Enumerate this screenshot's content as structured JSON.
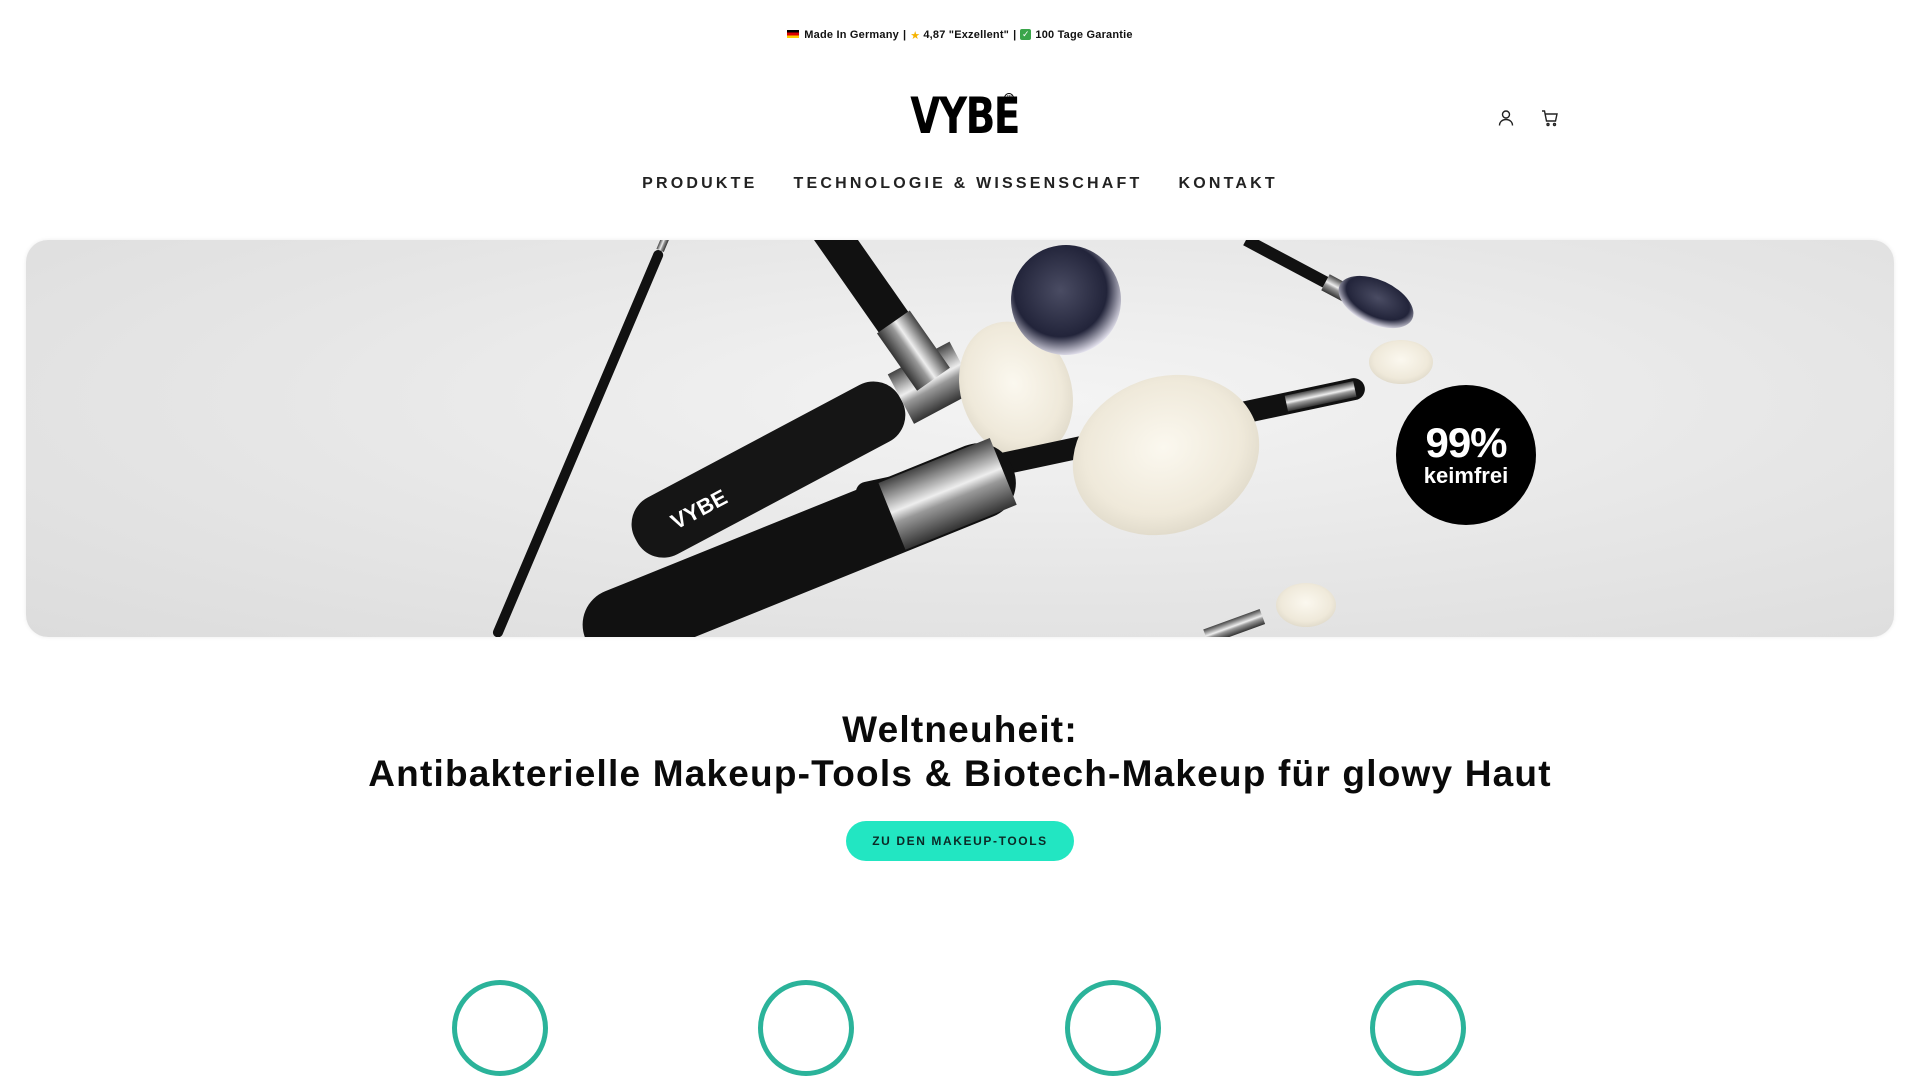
{
  "announcement": {
    "made_in": "Made In Germany",
    "rating": "4,87 \"Exzellent\"",
    "guarantee": "100 Tage Garantie",
    "separator": "|"
  },
  "brand": {
    "name": "VYBE",
    "mark": "™"
  },
  "header_icons": [
    "account-icon",
    "cart-icon"
  ],
  "nav": {
    "items": [
      "PRODUKTE",
      "TECHNOLOGIE & WISSENSCHAFT",
      "KONTAKT"
    ]
  },
  "hero": {
    "badge_value": "99%",
    "badge_label": "keimfrei",
    "brush_brand": "VYBE"
  },
  "headline": {
    "line1": "Weltneuheit:",
    "line2": "Antibakterielle Makeup-Tools & Biotech-Makeup für glowy Haut"
  },
  "cta": {
    "label": "ZU DEN MAKEUP-TOOLS"
  },
  "colors": {
    "accent": "#22e6c2",
    "teal_ring": "#2bb39a",
    "text": "#111111"
  }
}
